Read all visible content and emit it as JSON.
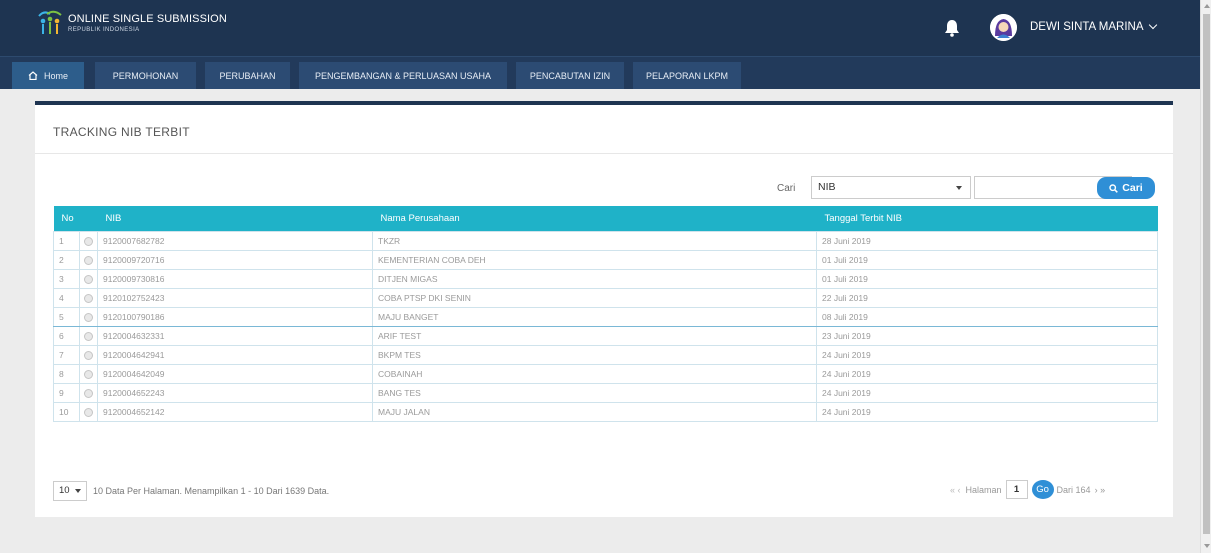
{
  "brand": {
    "title": "ONLINE SINGLE SUBMISSION",
    "subtitle": "REPUBLIK INDONESIA"
  },
  "user": {
    "name": "DEWI SINTA MARINA"
  },
  "nav": {
    "home": "Home",
    "items": [
      "PERMOHONAN",
      "PERUBAHAN",
      "PENGEMBANGAN & PERLUASAN USAHA",
      "PENCABUTAN IZIN",
      "PELAPORAN LKPM"
    ]
  },
  "panel": {
    "title": "TRACKING NIB TERBIT"
  },
  "search": {
    "label": "Cari",
    "field": "NIB",
    "value": "",
    "button": "Cari"
  },
  "table": {
    "headers": [
      "No",
      "NIB",
      "Nama Perusahaan",
      "Tanggal Terbit NIB"
    ],
    "rows": [
      {
        "no": "1",
        "nib": "9120007682782",
        "nama": "TKZR",
        "tanggal": "28 Juni 2019"
      },
      {
        "no": "2",
        "nib": "9120009720716",
        "nama": "KEMENTERIAN COBA DEH",
        "tanggal": "01 Juli 2019"
      },
      {
        "no": "3",
        "nib": "9120009730816",
        "nama": "DITJEN MIGAS",
        "tanggal": "01 Juli 2019"
      },
      {
        "no": "4",
        "nib": "9120102752423",
        "nama": "COBA PTSP DKI SENIN",
        "tanggal": "22 Juli 2019"
      },
      {
        "no": "5",
        "nib": "9120100790186",
        "nama": "MAJU BANGET",
        "tanggal": "08 Juli 2019"
      },
      {
        "no": "6",
        "nib": "9120004632331",
        "nama": "ARIF TEST",
        "tanggal": "23 Juni 2019"
      },
      {
        "no": "7",
        "nib": "9120004642941",
        "nama": "BKPM TES",
        "tanggal": "24 Juni 2019"
      },
      {
        "no": "8",
        "nib": "9120004642049",
        "nama": "COBAINAH",
        "tanggal": "24 Juni 2019"
      },
      {
        "no": "9",
        "nib": "9120004652243",
        "nama": "BANG TES",
        "tanggal": "24 Juni 2019"
      },
      {
        "no": "10",
        "nib": "9120004652142",
        "nama": "MAJU JALAN",
        "tanggal": "24 Juni 2019"
      }
    ]
  },
  "footer": {
    "per_page": "10",
    "info": "10 Data Per Halaman. Menampilkan 1 - 10 Dari 1639 Data.",
    "first_prev": "« ‹",
    "halaman_label": "Halaman",
    "page": "1",
    "go": "Go",
    "total": "Dari 164",
    "next_last": "› »"
  },
  "colors": {
    "topbar": "#1e3451",
    "table_header": "#1fb2c8",
    "accent": "#2f8fd6"
  }
}
